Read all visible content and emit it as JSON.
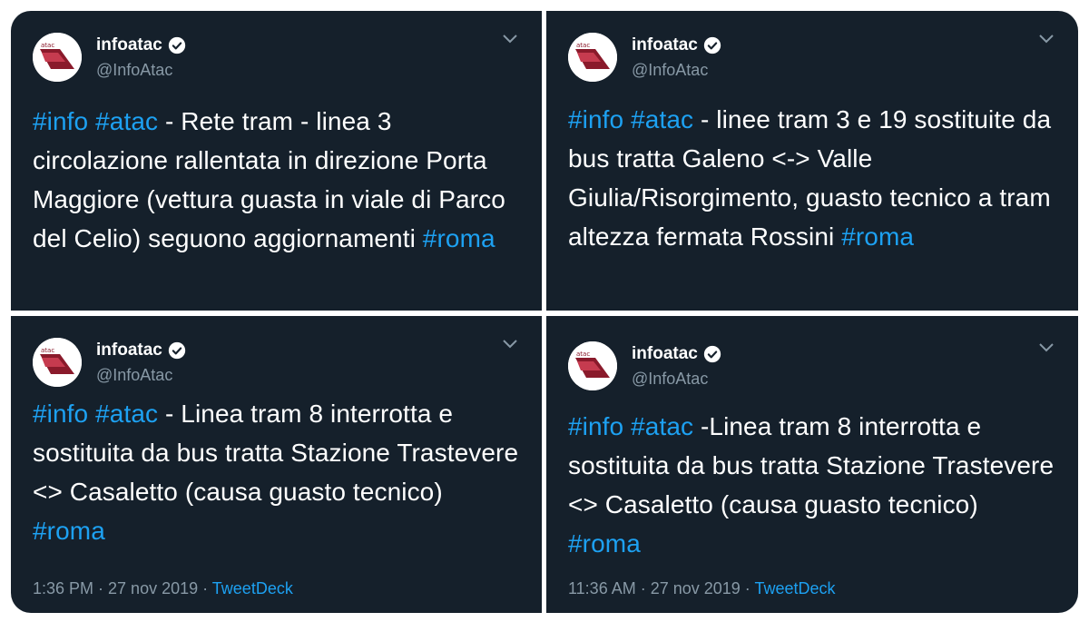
{
  "tweets": [
    {
      "name": "infoatac",
      "handle": "@InfoAtac",
      "hashtags_lead": "#info #atac",
      "text": " - Rete tram - linea 3 circolazione rallentata in direzione Porta Maggiore (vettura guasta in viale di Parco del Celio) seguono aggiornamenti ",
      "hashtag_tail": "#roma"
    },
    {
      "name": "infoatac",
      "handle": "@InfoAtac",
      "hashtags_lead": "#info #atac",
      "text": " - linee tram 3 e 19 sostituite da bus tratta Galeno <-> Valle Giulia/Risorgimento,  guasto tecnico a tram altezza fermata Rossini ",
      "hashtag_tail": "#roma"
    },
    {
      "name": "infoatac",
      "handle": "@InfoAtac",
      "hashtags_lead": "#info #atac",
      "text": "  - Linea tram 8 interrotta e sostituita da bus tratta Stazione Trastevere <> Casaletto (causa guasto tecnico) ",
      "hashtag_tail": "#roma",
      "time": "1:36 PM · 27 nov 2019 · ",
      "source": "TweetDeck"
    },
    {
      "name": "infoatac",
      "handle": "@InfoAtac",
      "hashtags_lead": "#info #atac",
      "text": " -Linea tram 8 interrotta e sostituita da bus tratta Stazione Trastevere <> Casaletto (causa guasto tecnico) ",
      "hashtag_tail": "#roma",
      "time": "11:36 AM · 27 nov 2019 · ",
      "source": "TweetDeck"
    }
  ],
  "colors": {
    "background": "#15202b",
    "hashtag": "#1da1f2",
    "secondary_text": "#8899a6"
  },
  "icons": [
    "avatar-logo",
    "verified-badge-icon",
    "chevron-down-icon"
  ]
}
